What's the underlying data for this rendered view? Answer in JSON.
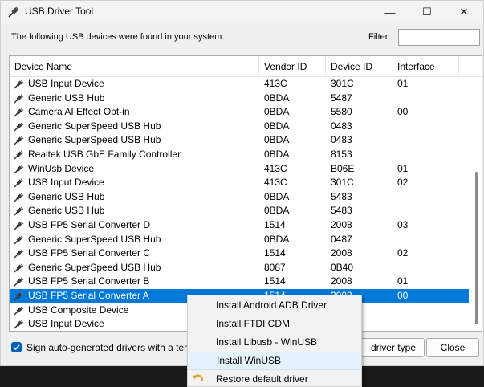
{
  "window": {
    "title": "USB Driver Tool",
    "minimize": "—",
    "maximize": "☐",
    "close": "✕"
  },
  "prompt": "The following USB devices were found in your system:",
  "filter": {
    "label": "Filter:",
    "value": "",
    "placeholder": ""
  },
  "columns": [
    "Device Name",
    "Vendor ID",
    "Device ID",
    "Interface"
  ],
  "rows": [
    {
      "name": "USB Input Device",
      "vid": "413C",
      "did": "301C",
      "iface": "01"
    },
    {
      "name": "Generic USB Hub",
      "vid": "0BDA",
      "did": "5487",
      "iface": ""
    },
    {
      "name": "Camera AI Effect Opt-in",
      "vid": "0BDA",
      "did": "5580",
      "iface": "00"
    },
    {
      "name": "Generic SuperSpeed USB Hub",
      "vid": "0BDA",
      "did": "0483",
      "iface": ""
    },
    {
      "name": "Generic SuperSpeed USB Hub",
      "vid": "0BDA",
      "did": "0483",
      "iface": ""
    },
    {
      "name": "Realtek USB GbE Family Controller",
      "vid": "0BDA",
      "did": "8153",
      "iface": ""
    },
    {
      "name": "WinUsb Device",
      "vid": "413C",
      "did": "B06E",
      "iface": "01"
    },
    {
      "name": "USB Input Device",
      "vid": "413C",
      "did": "301C",
      "iface": "02"
    },
    {
      "name": "Generic USB Hub",
      "vid": "0BDA",
      "did": "5483",
      "iface": ""
    },
    {
      "name": "Generic USB Hub",
      "vid": "0BDA",
      "did": "5483",
      "iface": ""
    },
    {
      "name": "USB FP5 Serial Converter D",
      "vid": "1514",
      "did": "2008",
      "iface": "03"
    },
    {
      "name": "Generic SuperSpeed USB Hub",
      "vid": "0BDA",
      "did": "0487",
      "iface": ""
    },
    {
      "name": "USB FP5 Serial Converter C",
      "vid": "1514",
      "did": "2008",
      "iface": "02"
    },
    {
      "name": "Generic SuperSpeed USB Hub",
      "vid": "8087",
      "did": "0B40",
      "iface": ""
    },
    {
      "name": "USB FP5 Serial Converter B",
      "vid": "1514",
      "did": "2008",
      "iface": "01"
    },
    {
      "name": "USB FP5 Serial Converter A",
      "vid": "1514",
      "did": "2008",
      "iface": "00"
    },
    {
      "name": "USB Composite Device",
      "vid": "",
      "did": "",
      "iface": ""
    },
    {
      "name": "USB Input Device",
      "vid": "",
      "did": "",
      "iface": ""
    }
  ],
  "selected_row": 15,
  "checkbox": {
    "label": "Sign auto-generated drivers with a tempo",
    "checked": true
  },
  "buttons": {
    "driver_type": "driver type",
    "close": "Close"
  },
  "context_menu": [
    {
      "label": "Install Android ADB Driver",
      "icon": ""
    },
    {
      "label": "Install FTDI CDM",
      "icon": ""
    },
    {
      "label": "Install Libusb - WinUSB",
      "icon": ""
    },
    {
      "label": "Install WinUSB",
      "icon": "",
      "hover": true
    },
    {
      "label": "Restore default driver",
      "icon": "undo-arrow-icon"
    }
  ],
  "colors": {
    "selection": "#0078d7",
    "menu_hover": "#e5f1fb",
    "checkbox": "#005fb8"
  }
}
